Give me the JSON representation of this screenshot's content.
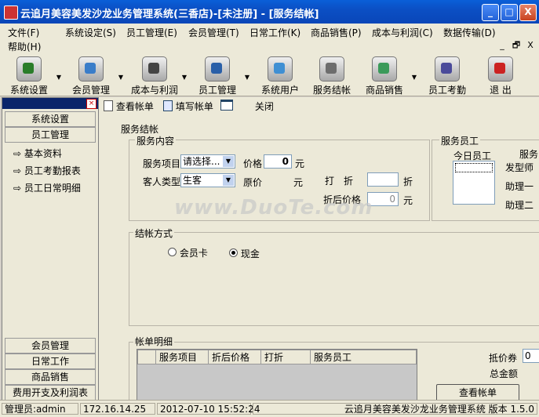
{
  "window": {
    "title": "云追月美容美发沙龙业务管理系统(三香店)-[未注册] - [服务结帐]",
    "buttons": [
      "_",
      "□",
      "X"
    ]
  },
  "menu": {
    "row1": [
      "文件(F)",
      "系统设定(S)",
      "员工管理(E)",
      "会员管理(T)",
      "日常工作(K)",
      "商品销售(P)",
      "成本与利润(C)",
      "数据传输(D)"
    ],
    "row2": [
      "帮助(H)"
    ],
    "mdi_buttons": [
      "_",
      "🗗",
      "X"
    ]
  },
  "toolbar": {
    "items": [
      {
        "label": "系统设置",
        "icon": "system-settings-icon",
        "color": "#2a7d2a"
      },
      {
        "label": "会员管理",
        "icon": "member-icon",
        "color": "#3a7dc9"
      },
      {
        "label": "成本与利润",
        "icon": "cost-profit-icon",
        "color": "#444444"
      },
      {
        "label": "员工管理",
        "icon": "staff-icon",
        "color": "#2a5fa8"
      },
      {
        "label": "系统用户",
        "icon": "system-user-icon",
        "color": "#3f8fd3"
      },
      {
        "label": "服务结帐",
        "icon": "service-checkout-icon",
        "color": "#6d6d6d"
      },
      {
        "label": "商品销售",
        "icon": "product-sales-icon",
        "color": "#3a9a5a"
      },
      {
        "label": "员工考勤",
        "icon": "attendance-icon",
        "color": "#4a4a9a"
      },
      {
        "label": "退 出",
        "icon": "exit-icon",
        "color": "#cc2222"
      }
    ]
  },
  "leftpanel": {
    "top_buttons": [
      "系统设置",
      "员工管理"
    ],
    "links": [
      "基本资料",
      "员工考勤报表",
      "员工日常明细"
    ],
    "bottom_buttons": [
      "会员管理",
      "日常工作",
      "商品销售",
      "费用开支及利润表"
    ]
  },
  "content": {
    "actions": [
      "查看帐单",
      "填写帐单",
      "关闭"
    ],
    "section_title": "服务结帐",
    "service_group": {
      "label": "服务内容",
      "service_item_label": "服务项目",
      "service_item_value": "请选择...",
      "price_label": "价格",
      "price_value": "0",
      "price_unit": "元",
      "customer_type_label": "客人类型",
      "customer_type_value": "生客",
      "original_price_label": "原价",
      "original_price_unit": "元",
      "discount_label": "打　折",
      "discount_unit": "折",
      "after_discount_label": "折后价格",
      "after_discount_value": "0",
      "after_discount_unit": "元"
    },
    "staff_group": {
      "label": "服务员工",
      "today_staff_label": "今日员工",
      "service_label": "服务",
      "roles": [
        "发型师",
        "助理一",
        "助理二"
      ]
    },
    "payment_group": {
      "label": "结帐方式",
      "options": [
        {
          "label": "会员卡",
          "selected": false
        },
        {
          "label": "现金",
          "selected": true
        }
      ]
    },
    "bill_group": {
      "label": "帐单明细",
      "columns": [
        "服务项目",
        "折后价格",
        "打折",
        "服务员工"
      ]
    },
    "summary": {
      "voucher_label": "抵价券",
      "voucher_value": "0",
      "total_label": "总金额",
      "view_bill_label": "查看帐单"
    }
  },
  "watermark": "www.DuoTe.com",
  "statusbar": {
    "user": "管理员:admin",
    "ip": "172.16.14.25",
    "datetime": "2012-07-10 15:52:24",
    "version": "云追月美容美发沙龙业务管理系统 版本 1.5.0"
  }
}
